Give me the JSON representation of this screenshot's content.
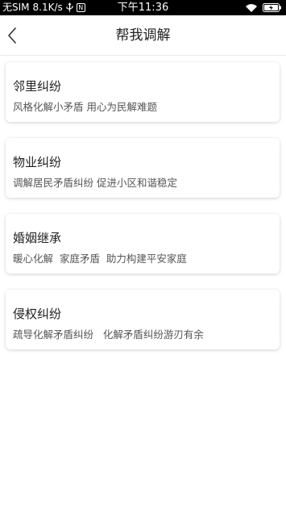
{
  "status_bar": {
    "carrier": "无SIM",
    "speed": "8.1K/s",
    "notify_badge": "N",
    "time": "下午11:36"
  },
  "nav": {
    "title": "帮我调解"
  },
  "items": [
    {
      "title": "邻里纠纷",
      "desc": "风格化解小矛盾 用心为民解难题"
    },
    {
      "title": "物业纠纷",
      "desc": "调解居民矛盾纠纷 促进小区和谐稳定"
    },
    {
      "title": "婚姻继承",
      "desc": "暖心化解  家庭矛盾  助力构建平安家庭"
    },
    {
      "title": "侵权纠纷",
      "desc": "疏导化解矛盾纠纷   化解矛盾纠纷游刃有余"
    }
  ],
  "colors": {
    "status_bar_bg": "#000000",
    "title_text": "#222222",
    "desc_text": "#555555"
  },
  "icons": {
    "usb": "usb-icon",
    "notify": "notification-icon",
    "wifi": "wifi-icon",
    "battery": "battery-charging-icon",
    "back": "chevron-left-icon"
  }
}
